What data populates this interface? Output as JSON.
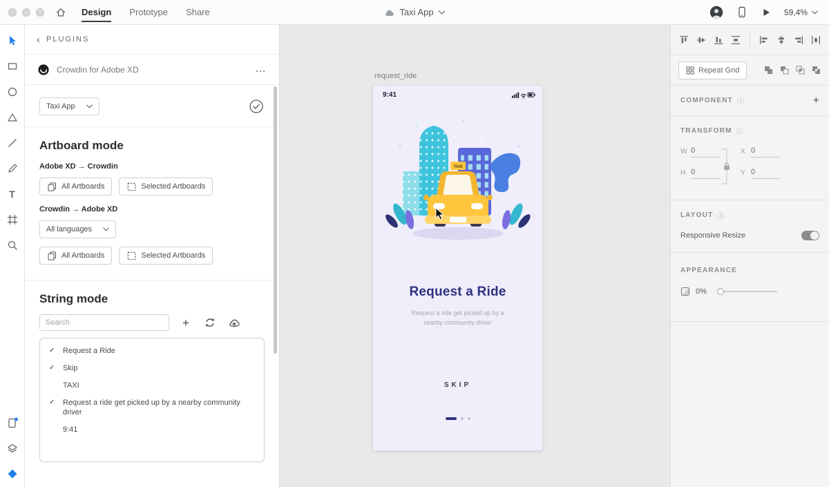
{
  "titlebar": {
    "tabs": [
      {
        "label": "Design",
        "active": true
      },
      {
        "label": "Prototype",
        "active": false
      },
      {
        "label": "Share",
        "active": false
      }
    ],
    "document_title": "Taxi App",
    "zoom_level": "59,4%"
  },
  "plugin_panel": {
    "back_label": "PLUGINS",
    "plugin_name": "Crowdin for Adobe XD",
    "project_selector": {
      "value": "Taxi App"
    },
    "sections": {
      "artboard_mode": {
        "title": "Artboard mode",
        "direction_xd_to_crowdin": "Adobe XD → Crowdin",
        "direction_crowdin_to_xd": "Crowdin → Adobe XD",
        "all_artboards_label": "All Artboards",
        "selected_artboards_label": "Selected Artboards",
        "language_selector": {
          "value": "All languages"
        }
      },
      "string_mode": {
        "title": "String mode",
        "search_placeholder": "Search",
        "strings": [
          {
            "check": "✓",
            "text": "Request a Ride"
          },
          {
            "check": "✓",
            "text": "Skip"
          },
          {
            "check": "",
            "text": "TAXI"
          },
          {
            "check": "✓",
            "text": "Request a ride get picked up by a nearby community driver"
          },
          {
            "check": "",
            "text": "9:41"
          }
        ]
      }
    }
  },
  "canvas": {
    "artboard_label": "request_ride",
    "artboard": {
      "status_time": "9:41",
      "taxi_sign": "TAXI",
      "title": "Request a Ride",
      "subtitle": "Request a ride get picked up by a nearby community driver",
      "skip_label": "SKIP"
    }
  },
  "right_panel": {
    "repeat_grid_label": "Repeat Grid",
    "component": {
      "title": "COMPONENT"
    },
    "transform": {
      "title": "TRANSFORM",
      "w_label": "W",
      "w_value": "0",
      "x_label": "X",
      "x_value": "0",
      "h_label": "H",
      "h_value": "0",
      "y_label": "Y",
      "y_value": "0"
    },
    "layout": {
      "title": "LAYOUT",
      "responsive_resize_label": "Responsive Resize",
      "responsive_resize_on": true
    },
    "appearance": {
      "title": "APPEARANCE",
      "opacity_value": "0%"
    }
  },
  "icons": {
    "back_chevron": "‹",
    "more": "…",
    "plus": "+",
    "info": "ⓘ"
  },
  "colors": {
    "accent_blue": "#2680eb",
    "artboard_bg": "#efeefa",
    "title_navy": "#2e3080",
    "taxi_yellow": "#ffc53d",
    "building_teal": "#3fc4dd",
    "building_indigo": "#5b68d8"
  }
}
